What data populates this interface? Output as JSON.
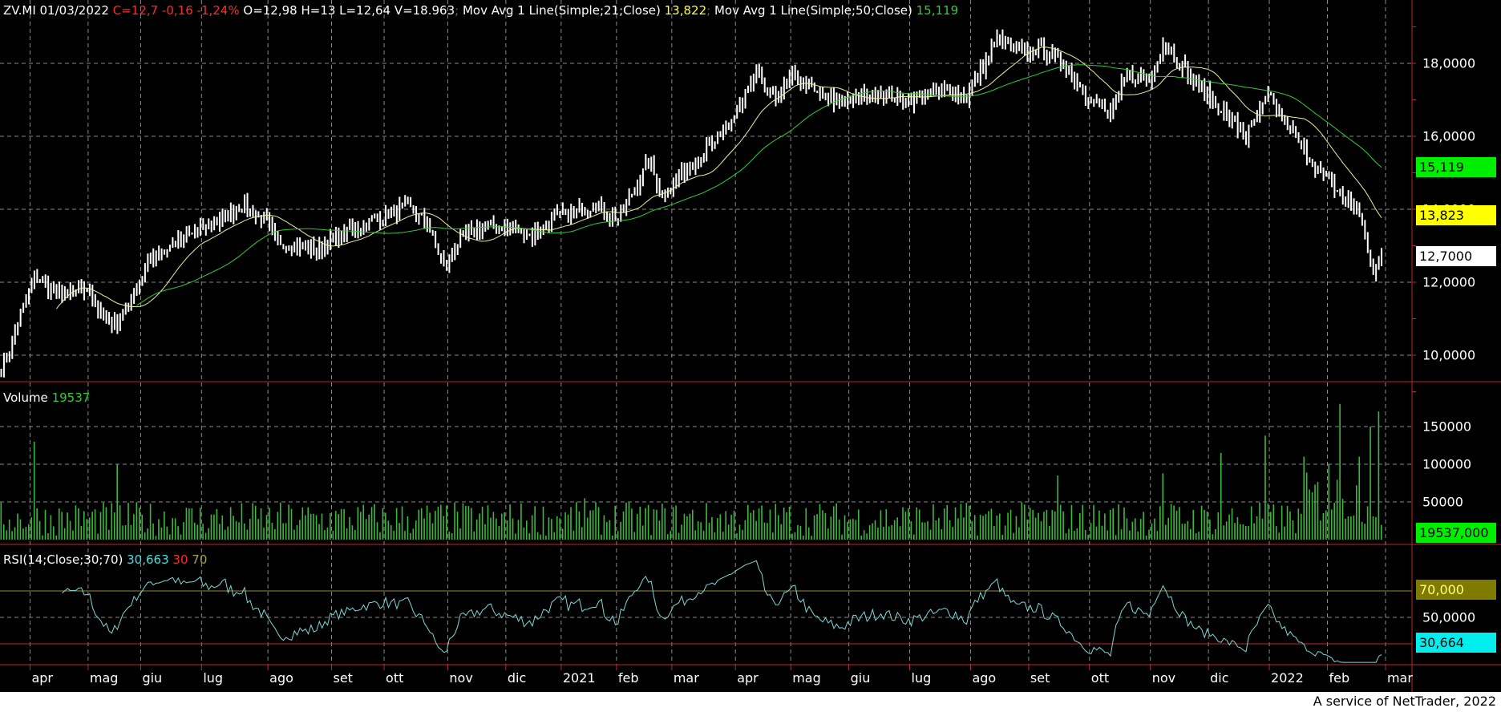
{
  "header": {
    "symbol_date": "ZV.MI 01/03/2022",
    "change": "C=12,7 -0,16 -1,24%",
    "ohlv": "O=12,98 H=13 L=12,64 V=18.963",
    "sep": ";",
    "ma21_label": "Mov Avg 1 Line(Simple;21;Close)",
    "ma21_value": "13,822",
    "ma50_label": "Mov Avg 1 Line(Simple;50;Close)",
    "ma50_value": "15,119"
  },
  "volume_header": {
    "label": "Volume",
    "value": "19537"
  },
  "rsi_header": {
    "label": "RSI(14;Close;30;70)",
    "value": "30,663",
    "low": "30",
    "high": "70"
  },
  "axis_boxes": {
    "ma50": "15,119",
    "ma21": "13,823",
    "last": "12,7000",
    "volume": "19537,000",
    "rsi_high": "70,000",
    "rsi": "30,664"
  },
  "colors": {
    "ma21": "#e8f0a0",
    "ma50": "#33cc33",
    "bars": "#ffffff",
    "volume": "#3cb83c",
    "rsi": "#7fd8d8",
    "grid": "#8a8a8a",
    "axis": "#c0262c"
  },
  "footer": "A service of NetTrader, 2022",
  "chart_data": [
    {
      "type": "ohlc",
      "title": "ZV.MI",
      "ylim": [
        9.27,
        19.74
      ],
      "yticks": [
        {
          "v": 10,
          "label": "10,0000"
        },
        {
          "v": 12,
          "label": "12,0000"
        },
        {
          "v": 14,
          "label": "14,0000"
        },
        {
          "v": 16,
          "label": "16,0000"
        },
        {
          "v": 18,
          "label": "18,0000"
        }
      ],
      "bar_count": 500,
      "close_keypoints": [
        [
          0,
          9.7
        ],
        [
          2,
          9.9
        ],
        [
          7,
          11.1
        ],
        [
          12,
          12.2
        ],
        [
          21,
          11.6
        ],
        [
          31,
          11.8
        ],
        [
          40,
          10.7
        ],
        [
          48,
          11.7
        ],
        [
          54,
          12.7
        ],
        [
          66,
          13.2
        ],
        [
          74,
          13.5
        ],
        [
          87,
          14.1
        ],
        [
          95,
          13.7
        ],
        [
          100,
          13.1
        ],
        [
          114,
          12.9
        ],
        [
          128,
          13.5
        ],
        [
          147,
          14.1
        ],
        [
          154,
          13.6
        ],
        [
          160,
          12.4
        ],
        [
          166,
          13.2
        ],
        [
          176,
          13.6
        ],
        [
          192,
          13.3
        ],
        [
          201,
          13.8
        ],
        [
          215,
          14.1
        ],
        [
          223,
          13.7
        ],
        [
          234,
          15.3
        ],
        [
          239,
          14.4
        ],
        [
          249,
          15.2
        ],
        [
          260,
          16.0
        ],
        [
          266,
          16.7
        ],
        [
          273,
          17.7
        ],
        [
          279,
          17.0
        ],
        [
          287,
          17.7
        ],
        [
          294,
          17.2
        ],
        [
          303,
          16.9
        ],
        [
          318,
          17.2
        ],
        [
          329,
          17.0
        ],
        [
          343,
          17.3
        ],
        [
          349,
          17.1
        ],
        [
          355,
          17.9
        ],
        [
          360,
          18.7
        ],
        [
          367,
          18.3
        ],
        [
          375,
          18.4
        ],
        [
          384,
          18.0
        ],
        [
          393,
          17.1
        ],
        [
          401,
          16.6
        ],
        [
          407,
          17.7
        ],
        [
          415,
          17.5
        ],
        [
          420,
          18.6
        ],
        [
          429,
          17.7
        ],
        [
          439,
          16.9
        ],
        [
          450,
          16.0
        ],
        [
          458,
          17.1
        ],
        [
          465,
          16.3
        ],
        [
          474,
          15.3
        ],
        [
          483,
          14.5
        ],
        [
          491,
          13.9
        ],
        [
          496,
          12.2
        ],
        [
          499,
          12.7
        ]
      ],
      "moving_averages": [
        {
          "name": "SMA 21",
          "period": 21,
          "last": 13.822
        },
        {
          "name": "SMA 50",
          "period": 50,
          "last": 15.119
        }
      ],
      "last_close": 12.7
    },
    {
      "type": "bar",
      "title": "Volume",
      "ylim": [
        0,
        209000
      ],
      "yticks": [
        {
          "v": 50000,
          "label": "50000"
        },
        {
          "v": 100000,
          "label": "100000"
        },
        {
          "v": 150000,
          "label": "150000"
        }
      ],
      "spikes": [
        [
          12,
          130000
        ],
        [
          42,
          100000
        ],
        [
          211,
          55000
        ],
        [
          382,
          85000
        ],
        [
          420,
          88000
        ],
        [
          441,
          115000
        ],
        [
          457,
          138000
        ],
        [
          471,
          110000
        ],
        [
          480,
          100000
        ],
        [
          484,
          180000
        ],
        [
          491,
          110000
        ],
        [
          495,
          150000
        ],
        [
          498,
          170000
        ]
      ],
      "last": 19537
    },
    {
      "type": "line",
      "title": "RSI(14)",
      "ylim": [
        14,
        105
      ],
      "yticks": [
        {
          "v": 50,
          "label": "50,0000"
        }
      ],
      "levels": [
        30,
        70
      ],
      "last": 30.663
    }
  ],
  "months": [
    {
      "label": "apr",
      "idx": 11
    },
    {
      "label": "mag",
      "idx": 32
    },
    {
      "label": "giu",
      "idx": 51
    },
    {
      "label": "lug",
      "idx": 73
    },
    {
      "label": "ago",
      "idx": 97
    },
    {
      "label": "set",
      "idx": 120
    },
    {
      "label": "ott",
      "idx": 139
    },
    {
      "label": "nov",
      "idx": 162
    },
    {
      "label": "dic",
      "idx": 183
    },
    {
      "label": "2021",
      "idx": 203
    },
    {
      "label": "feb",
      "idx": 223
    },
    {
      "label": "mar",
      "idx": 243
    },
    {
      "label": "apr",
      "idx": 266
    },
    {
      "label": "mag",
      "idx": 286
    },
    {
      "label": "giu",
      "idx": 307
    },
    {
      "label": "lug",
      "idx": 329
    },
    {
      "label": "ago",
      "idx": 351
    },
    {
      "label": "set",
      "idx": 372
    },
    {
      "label": "ott",
      "idx": 394
    },
    {
      "label": "nov",
      "idx": 416
    },
    {
      "label": "dic",
      "idx": 437
    },
    {
      "label": "2022",
      "idx": 459
    },
    {
      "label": "feb",
      "idx": 480
    },
    {
      "label": "mar",
      "idx": 501
    }
  ]
}
